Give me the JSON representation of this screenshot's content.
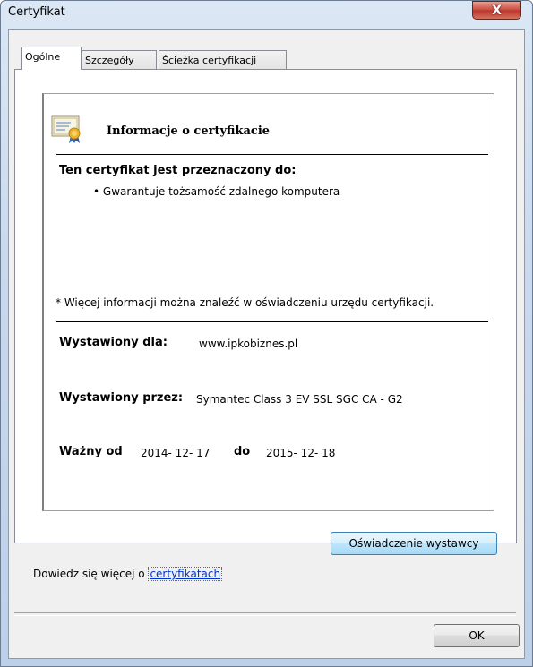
{
  "window": {
    "title": "Certyfikat",
    "close_label": "X"
  },
  "tabs": [
    {
      "label": "Ogólne",
      "active": true
    },
    {
      "label": "Szczegóły",
      "active": false
    },
    {
      "label": "Ścieżka certyfikacji",
      "active": false
    }
  ],
  "info": {
    "title": "Informacje o certyfikacie",
    "purpose_heading": "Ten certyfikat jest przeznaczony do:",
    "purpose_items": [
      "• Gwarantuje tożsamość zdalnego komputera"
    ],
    "footnote": "* Więcej informacji można znaleźć w oświadczeniu urzędu certyfikacji.",
    "issued_to_label": "Wystawiony dla:",
    "issued_to_value": "www.ipkobiznes.pl",
    "issued_by_label": "Wystawiony przez:",
    "issued_by_value": "Symantec Class 3 EV SSL SGC CA - G2",
    "valid_from_label": "Ważny od",
    "valid_from_value": "2014- 12- 17",
    "valid_to_label": "do",
    "valid_to_value": "2015- 12- 18"
  },
  "buttons": {
    "issuer_statement": "Oświadczenie wystawcy",
    "ok": "OK"
  },
  "learn_more": {
    "prefix": "Dowiedz się więcej o ",
    "link": "certyfikatach"
  },
  "colors": {
    "link": "#0033cc",
    "close_button": "#c9473b"
  }
}
